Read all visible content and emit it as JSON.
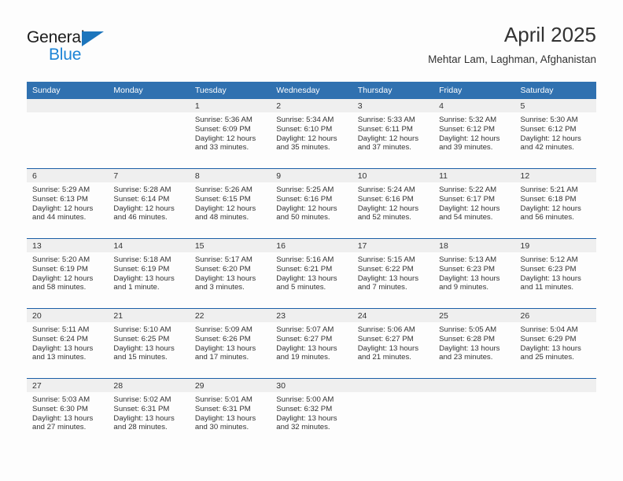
{
  "brand": {
    "name_part1": "General",
    "name_part2": "Blue",
    "triangle_icon": "triangle-icon",
    "accent_color": "#1c84d6",
    "logo_dark_color": "#1b1b1b"
  },
  "header": {
    "title": "April 2025",
    "subtitle": "Mehtar Lam, Laghman, Afghanistan"
  },
  "theme": {
    "header_blue": "#3071b0",
    "row_divider_blue": "#1b5fa6",
    "daynum_band": "#efefef",
    "page_background": "#fdfdfd",
    "text_color": "#333333"
  },
  "calendar": {
    "weekday_headers": [
      "Sunday",
      "Monday",
      "Tuesday",
      "Wednesday",
      "Thursday",
      "Friday",
      "Saturday"
    ],
    "weeks": [
      [
        {
          "day": "",
          "empty": true,
          "sunrise": "",
          "sunset": "",
          "daylight_line1": "",
          "daylight_line2": ""
        },
        {
          "day": "",
          "empty": true,
          "sunrise": "",
          "sunset": "",
          "daylight_line1": "",
          "daylight_line2": ""
        },
        {
          "day": "1",
          "empty": false,
          "sunrise": "Sunrise: 5:36 AM",
          "sunset": "Sunset: 6:09 PM",
          "daylight_line1": "Daylight: 12 hours",
          "daylight_line2": "and 33 minutes."
        },
        {
          "day": "2",
          "empty": false,
          "sunrise": "Sunrise: 5:34 AM",
          "sunset": "Sunset: 6:10 PM",
          "daylight_line1": "Daylight: 12 hours",
          "daylight_line2": "and 35 minutes."
        },
        {
          "day": "3",
          "empty": false,
          "sunrise": "Sunrise: 5:33 AM",
          "sunset": "Sunset: 6:11 PM",
          "daylight_line1": "Daylight: 12 hours",
          "daylight_line2": "and 37 minutes."
        },
        {
          "day": "4",
          "empty": false,
          "sunrise": "Sunrise: 5:32 AM",
          "sunset": "Sunset: 6:12 PM",
          "daylight_line1": "Daylight: 12 hours",
          "daylight_line2": "and 39 minutes."
        },
        {
          "day": "5",
          "empty": false,
          "sunrise": "Sunrise: 5:30 AM",
          "sunset": "Sunset: 6:12 PM",
          "daylight_line1": "Daylight: 12 hours",
          "daylight_line2": "and 42 minutes."
        }
      ],
      [
        {
          "day": "6",
          "empty": false,
          "sunrise": "Sunrise: 5:29 AM",
          "sunset": "Sunset: 6:13 PM",
          "daylight_line1": "Daylight: 12 hours",
          "daylight_line2": "and 44 minutes."
        },
        {
          "day": "7",
          "empty": false,
          "sunrise": "Sunrise: 5:28 AM",
          "sunset": "Sunset: 6:14 PM",
          "daylight_line1": "Daylight: 12 hours",
          "daylight_line2": "and 46 minutes."
        },
        {
          "day": "8",
          "empty": false,
          "sunrise": "Sunrise: 5:26 AM",
          "sunset": "Sunset: 6:15 PM",
          "daylight_line1": "Daylight: 12 hours",
          "daylight_line2": "and 48 minutes."
        },
        {
          "day": "9",
          "empty": false,
          "sunrise": "Sunrise: 5:25 AM",
          "sunset": "Sunset: 6:16 PM",
          "daylight_line1": "Daylight: 12 hours",
          "daylight_line2": "and 50 minutes."
        },
        {
          "day": "10",
          "empty": false,
          "sunrise": "Sunrise: 5:24 AM",
          "sunset": "Sunset: 6:16 PM",
          "daylight_line1": "Daylight: 12 hours",
          "daylight_line2": "and 52 minutes."
        },
        {
          "day": "11",
          "empty": false,
          "sunrise": "Sunrise: 5:22 AM",
          "sunset": "Sunset: 6:17 PM",
          "daylight_line1": "Daylight: 12 hours",
          "daylight_line2": "and 54 minutes."
        },
        {
          "day": "12",
          "empty": false,
          "sunrise": "Sunrise: 5:21 AM",
          "sunset": "Sunset: 6:18 PM",
          "daylight_line1": "Daylight: 12 hours",
          "daylight_line2": "and 56 minutes."
        }
      ],
      [
        {
          "day": "13",
          "empty": false,
          "sunrise": "Sunrise: 5:20 AM",
          "sunset": "Sunset: 6:19 PM",
          "daylight_line1": "Daylight: 12 hours",
          "daylight_line2": "and 58 minutes."
        },
        {
          "day": "14",
          "empty": false,
          "sunrise": "Sunrise: 5:18 AM",
          "sunset": "Sunset: 6:19 PM",
          "daylight_line1": "Daylight: 13 hours",
          "daylight_line2": "and 1 minute."
        },
        {
          "day": "15",
          "empty": false,
          "sunrise": "Sunrise: 5:17 AM",
          "sunset": "Sunset: 6:20 PM",
          "daylight_line1": "Daylight: 13 hours",
          "daylight_line2": "and 3 minutes."
        },
        {
          "day": "16",
          "empty": false,
          "sunrise": "Sunrise: 5:16 AM",
          "sunset": "Sunset: 6:21 PM",
          "daylight_line1": "Daylight: 13 hours",
          "daylight_line2": "and 5 minutes."
        },
        {
          "day": "17",
          "empty": false,
          "sunrise": "Sunrise: 5:15 AM",
          "sunset": "Sunset: 6:22 PM",
          "daylight_line1": "Daylight: 13 hours",
          "daylight_line2": "and 7 minutes."
        },
        {
          "day": "18",
          "empty": false,
          "sunrise": "Sunrise: 5:13 AM",
          "sunset": "Sunset: 6:23 PM",
          "daylight_line1": "Daylight: 13 hours",
          "daylight_line2": "and 9 minutes."
        },
        {
          "day": "19",
          "empty": false,
          "sunrise": "Sunrise: 5:12 AM",
          "sunset": "Sunset: 6:23 PM",
          "daylight_line1": "Daylight: 13 hours",
          "daylight_line2": "and 11 minutes."
        }
      ],
      [
        {
          "day": "20",
          "empty": false,
          "sunrise": "Sunrise: 5:11 AM",
          "sunset": "Sunset: 6:24 PM",
          "daylight_line1": "Daylight: 13 hours",
          "daylight_line2": "and 13 minutes."
        },
        {
          "day": "21",
          "empty": false,
          "sunrise": "Sunrise: 5:10 AM",
          "sunset": "Sunset: 6:25 PM",
          "daylight_line1": "Daylight: 13 hours",
          "daylight_line2": "and 15 minutes."
        },
        {
          "day": "22",
          "empty": false,
          "sunrise": "Sunrise: 5:09 AM",
          "sunset": "Sunset: 6:26 PM",
          "daylight_line1": "Daylight: 13 hours",
          "daylight_line2": "and 17 minutes."
        },
        {
          "day": "23",
          "empty": false,
          "sunrise": "Sunrise: 5:07 AM",
          "sunset": "Sunset: 6:27 PM",
          "daylight_line1": "Daylight: 13 hours",
          "daylight_line2": "and 19 minutes."
        },
        {
          "day": "24",
          "empty": false,
          "sunrise": "Sunrise: 5:06 AM",
          "sunset": "Sunset: 6:27 PM",
          "daylight_line1": "Daylight: 13 hours",
          "daylight_line2": "and 21 minutes."
        },
        {
          "day": "25",
          "empty": false,
          "sunrise": "Sunrise: 5:05 AM",
          "sunset": "Sunset: 6:28 PM",
          "daylight_line1": "Daylight: 13 hours",
          "daylight_line2": "and 23 minutes."
        },
        {
          "day": "26",
          "empty": false,
          "sunrise": "Sunrise: 5:04 AM",
          "sunset": "Sunset: 6:29 PM",
          "daylight_line1": "Daylight: 13 hours",
          "daylight_line2": "and 25 minutes."
        }
      ],
      [
        {
          "day": "27",
          "empty": false,
          "sunrise": "Sunrise: 5:03 AM",
          "sunset": "Sunset: 6:30 PM",
          "daylight_line1": "Daylight: 13 hours",
          "daylight_line2": "and 27 minutes."
        },
        {
          "day": "28",
          "empty": false,
          "sunrise": "Sunrise: 5:02 AM",
          "sunset": "Sunset: 6:31 PM",
          "daylight_line1": "Daylight: 13 hours",
          "daylight_line2": "and 28 minutes."
        },
        {
          "day": "29",
          "empty": false,
          "sunrise": "Sunrise: 5:01 AM",
          "sunset": "Sunset: 6:31 PM",
          "daylight_line1": "Daylight: 13 hours",
          "daylight_line2": "and 30 minutes."
        },
        {
          "day": "30",
          "empty": false,
          "sunrise": "Sunrise: 5:00 AM",
          "sunset": "Sunset: 6:32 PM",
          "daylight_line1": "Daylight: 13 hours",
          "daylight_line2": "and 32 minutes."
        },
        {
          "day": "",
          "empty": true,
          "sunrise": "",
          "sunset": "",
          "daylight_line1": "",
          "daylight_line2": ""
        },
        {
          "day": "",
          "empty": true,
          "sunrise": "",
          "sunset": "",
          "daylight_line1": "",
          "daylight_line2": ""
        },
        {
          "day": "",
          "empty": true,
          "sunrise": "",
          "sunset": "",
          "daylight_line1": "",
          "daylight_line2": ""
        }
      ]
    ]
  }
}
